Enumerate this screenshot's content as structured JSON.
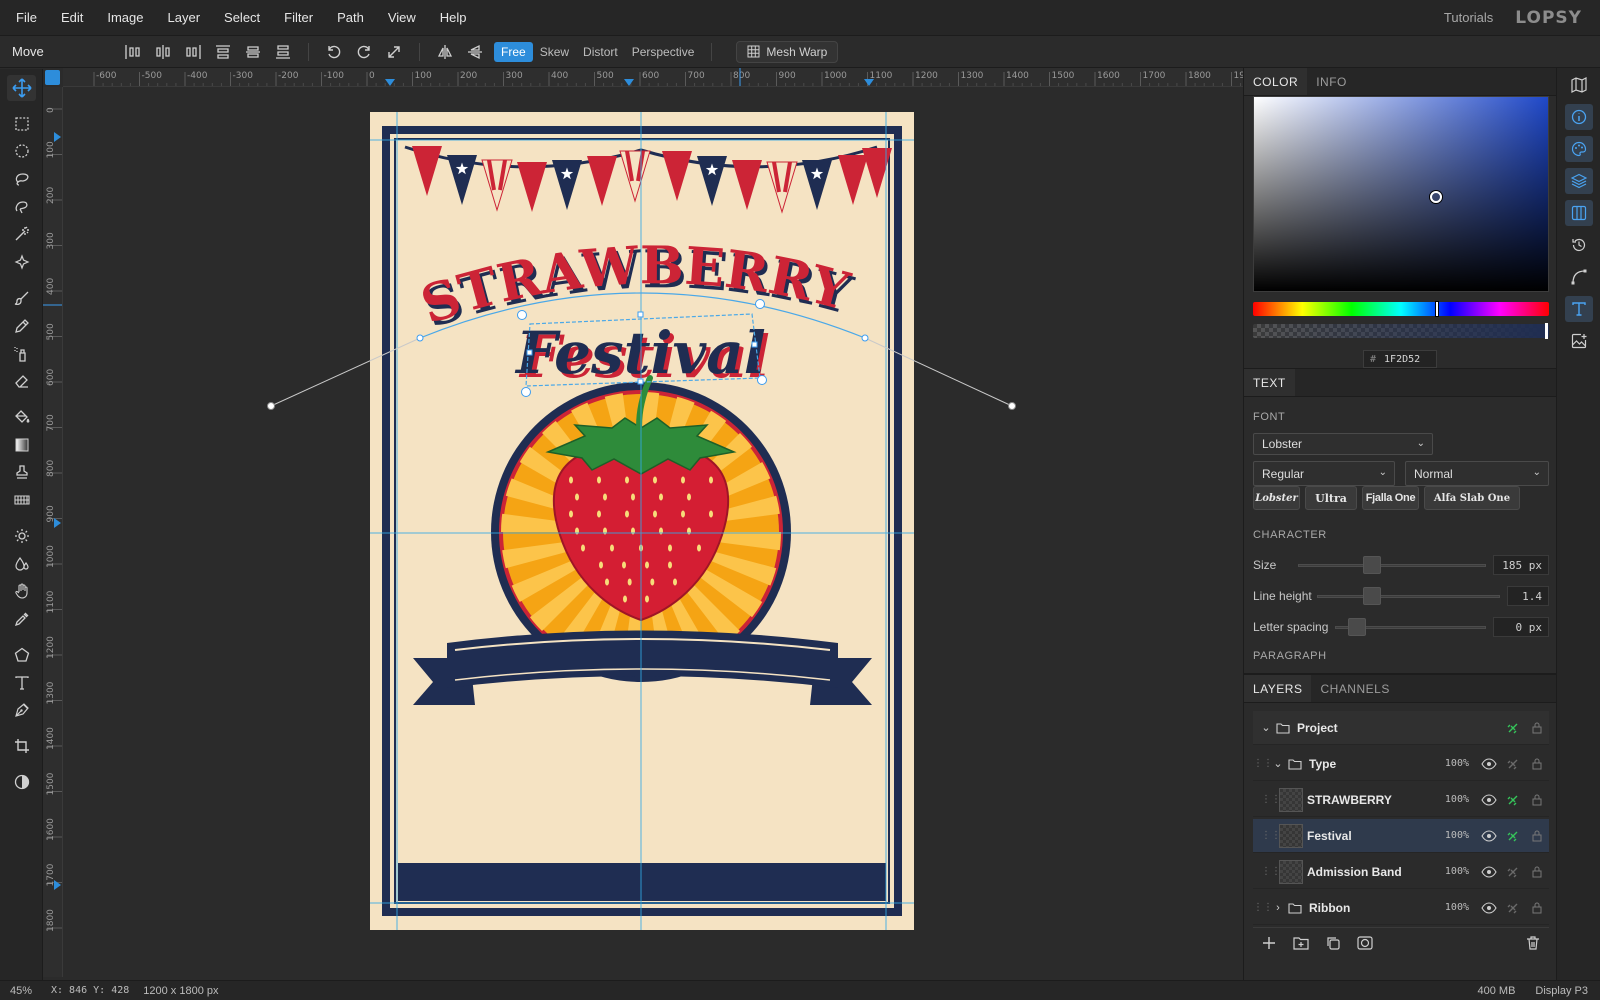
{
  "menubar": {
    "items": [
      "File",
      "Edit",
      "Image",
      "Layer",
      "Select",
      "Filter",
      "Path",
      "View",
      "Help"
    ],
    "tutorials": "Tutorials",
    "logo": "LOPSY"
  },
  "options_bar": {
    "tool_name": "Move",
    "transform_modes": [
      "Free",
      "Skew",
      "Distort",
      "Perspective"
    ],
    "active_mode": "Free",
    "mesh_warp": "Mesh Warp"
  },
  "rulers": {
    "top_ticks": [
      "-600",
      "-500",
      "-400",
      "-300",
      "-200",
      "-100",
      "0",
      "100",
      "200",
      "300",
      "400",
      "500",
      "600",
      "700",
      "800",
      "900",
      "1000",
      "1100",
      "1200",
      "1300",
      "1400",
      "1500",
      "1600",
      "1700",
      "1800",
      "19"
    ],
    "left_ticks": [
      "0",
      "100",
      "200",
      "300",
      "400",
      "500",
      "600",
      "700",
      "800",
      "900",
      "1000",
      "1100",
      "1200",
      "1300",
      "1400",
      "1500",
      "1600",
      "1700",
      "1800"
    ]
  },
  "poster": {
    "headline": "STRAWBERRY",
    "subhead": "Festival",
    "colors": {
      "cream": "#f5e3c3",
      "navy": "#1f2d52",
      "red": "#cc2436",
      "orange": "#f5a414",
      "green": "#2e8b3a"
    }
  },
  "status": {
    "zoom": "45%",
    "coords": "X: 846 Y: 428",
    "doc_size": "1200 x 1800 px",
    "memory": "400 MB",
    "profile": "Display P3"
  },
  "color_panel": {
    "tabs": [
      "COLOR",
      "INFO"
    ],
    "hex_hash": "#",
    "hex": "1F2D52"
  },
  "text_panel": {
    "tab": "TEXT",
    "font_label": "FONT",
    "font_family": "Lobster",
    "font_style": "Regular",
    "font_case": "Normal",
    "font_chips": [
      "Lobster",
      "Ultra",
      "Fjalla One",
      "Alfa Slab One"
    ],
    "character_label": "CHARACTER",
    "size_label": "Size",
    "size_value": "185 px",
    "size_level": 0.38,
    "line_height_label": "Line height",
    "line_height_value": "1.4",
    "line_height_level": 0.28,
    "letter_spacing_label": "Letter spacing",
    "letter_spacing_value": "0 px",
    "letter_spacing_level": 0.1,
    "paragraph_label": "PARAGRAPH"
  },
  "layers_panel": {
    "tabs": [
      "LAYERS",
      "CHANNELS"
    ],
    "rows": [
      {
        "name": "Project",
        "opacity": ""
      },
      {
        "name": "Type",
        "opacity": "100%"
      },
      {
        "name": "STRAWBERRY",
        "opacity": "100%"
      },
      {
        "name": "Festival",
        "opacity": "100%"
      },
      {
        "name": "Admission Band",
        "opacity": "100%"
      },
      {
        "name": "Ribbon",
        "opacity": "100%"
      }
    ]
  }
}
